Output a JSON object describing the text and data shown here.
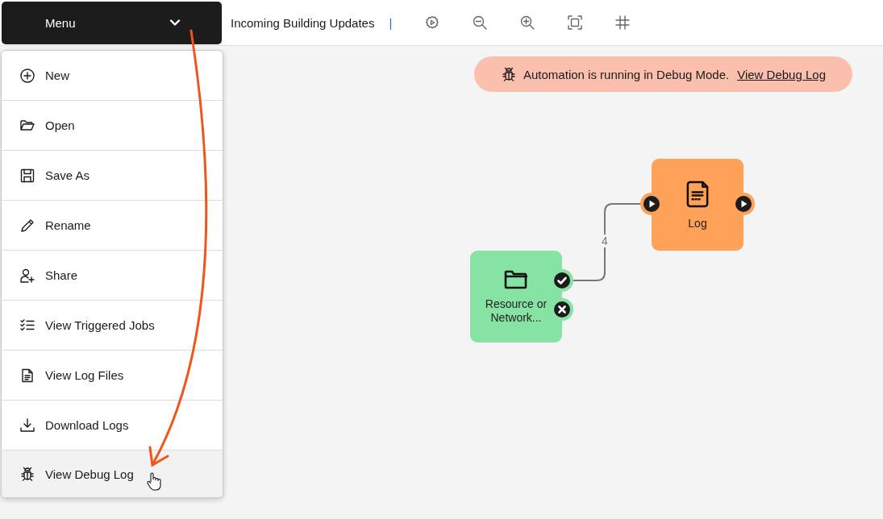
{
  "toolbar": {
    "menu_button": "Menu",
    "document_title": "Incoming Building Updates",
    "separator": "|"
  },
  "menu": {
    "items": [
      {
        "label": "New",
        "highlighted": false
      },
      {
        "label": "Open",
        "highlighted": false
      },
      {
        "label": "Save As",
        "highlighted": false
      },
      {
        "label": "Rename",
        "highlighted": false
      },
      {
        "label": "Share",
        "highlighted": false
      },
      {
        "label": "View Triggered Jobs",
        "highlighted": false
      },
      {
        "label": "View Log Files",
        "highlighted": false
      },
      {
        "label": "Download Logs",
        "highlighted": false
      },
      {
        "label": "View Debug Log",
        "highlighted": true
      }
    ]
  },
  "banner": {
    "message": "Automation is running in Debug Mode.",
    "link": "View Debug Log"
  },
  "canvas": {
    "nodes": [
      {
        "kind": "source",
        "label": "Resource or Network...",
        "color": "#86e3a3"
      },
      {
        "kind": "action",
        "label": "Log",
        "color": "#ffa157"
      }
    ],
    "connectors": [
      {
        "label": "4"
      }
    ]
  }
}
